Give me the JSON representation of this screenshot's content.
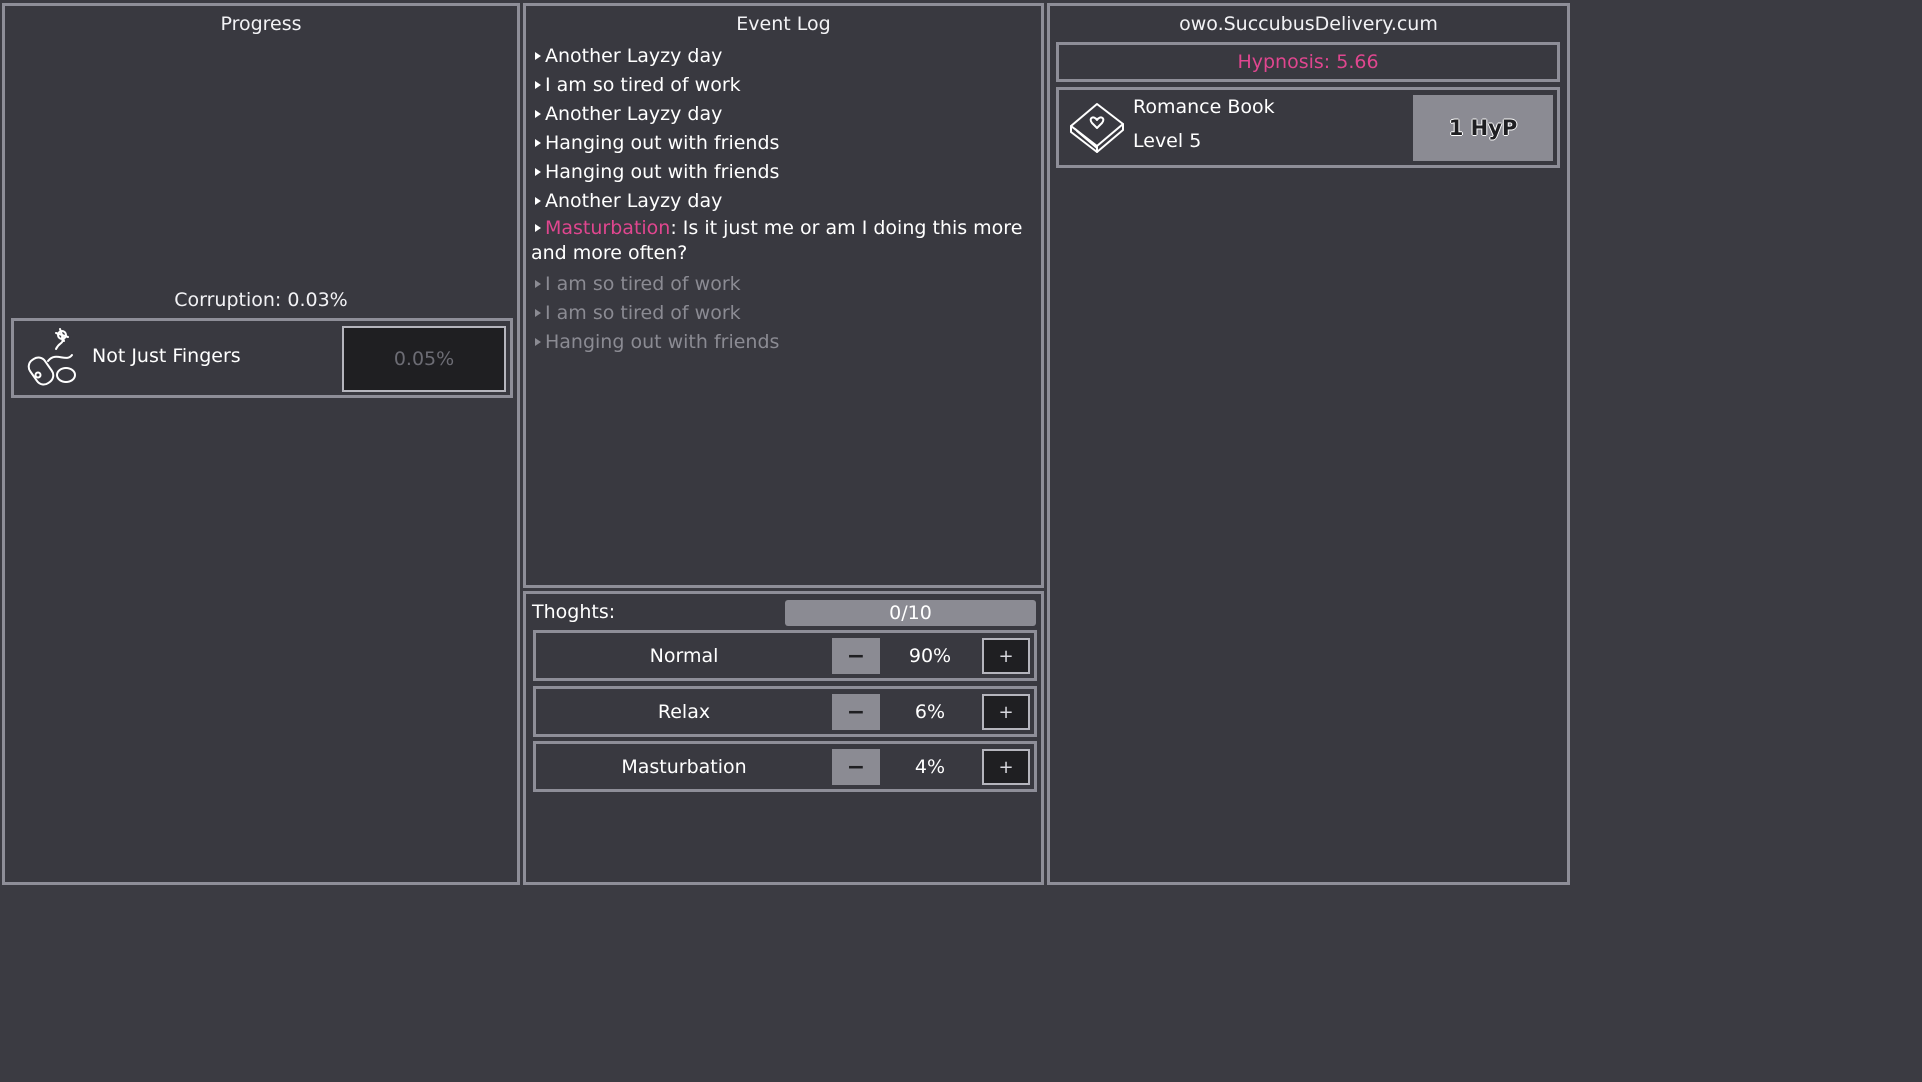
{
  "progress": {
    "title": "Progress",
    "corruption": "Corruption: 0.03%",
    "upgrade": {
      "name": "Not Just Fingers",
      "cost": "0.05%",
      "icon": "vibrator-icon"
    }
  },
  "event_log": {
    "title": "Event Log",
    "entries": [
      "Another Layzy day",
      "I am so tired of work",
      "Another Layzy day",
      "Hanging out with friends",
      "Hanging out with friends",
      "Another Layzy day"
    ],
    "highlight_entry": {
      "tag": "Masturbation",
      "text": ": Is it just me or am I doing this more and more often?"
    },
    "faded_entries": [
      "I am so tired of work",
      "I am so tired of work",
      "Hanging out with friends"
    ]
  },
  "thoughts": {
    "label": "Thoghts:",
    "count": "0/10",
    "rows": [
      {
        "name": "Normal",
        "pct": "90%",
        "minus": "−",
        "plus": "+"
      },
      {
        "name": "Relax",
        "pct": "6%",
        "minus": "−",
        "plus": "+"
      },
      {
        "name": "Masturbation",
        "pct": "4%",
        "minus": "−",
        "plus": "+"
      }
    ]
  },
  "shop": {
    "title": "owo.SuccubusDelivery.cum",
    "hypnosis": "Hypnosis: 5.66",
    "item": {
      "name": "Romance Book",
      "level": "Level 5",
      "buy": "1 HyP",
      "icon": "book-icon"
    }
  },
  "colors": {
    "accent": "#e0468f",
    "panel": "#393940",
    "border": "#8e8e98"
  }
}
